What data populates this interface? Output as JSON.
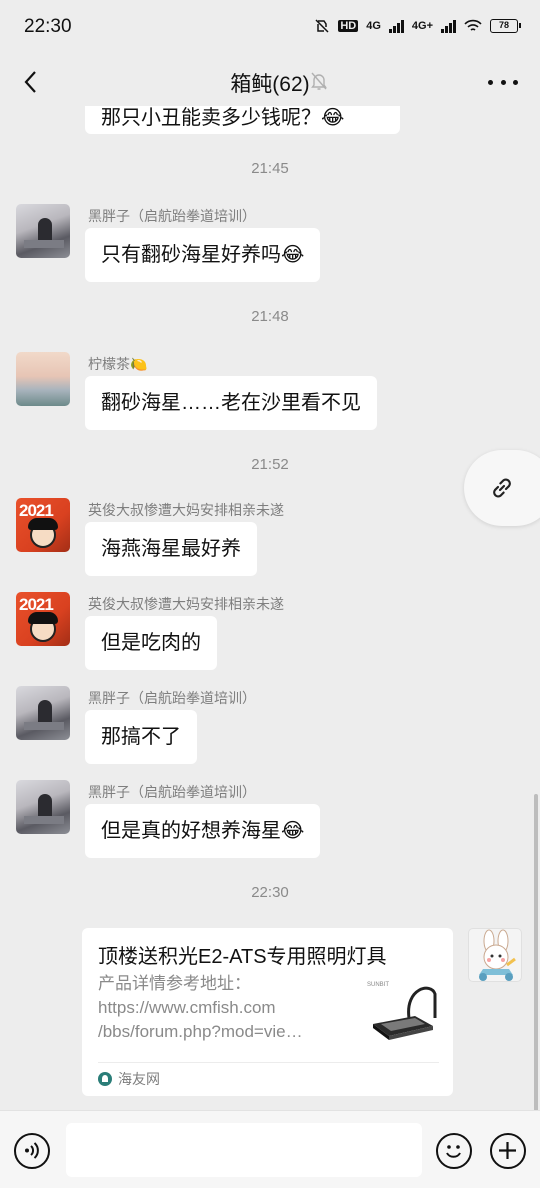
{
  "status": {
    "time": "22:30",
    "hd": "HD",
    "net1": "4G",
    "net2": "4G+",
    "battery": "78"
  },
  "header": {
    "title": "箱鲀(62)",
    "back_icon": "back-chevron-icon",
    "mute_icon": "bell-muted-icon",
    "more_icon": "more-dots-icon"
  },
  "chat": {
    "partial_message": "那只小丑能卖多少钱呢？😂",
    "times": [
      "21:45",
      "21:48",
      "21:52",
      "22:30"
    ],
    "messages": [
      {
        "sender": "黑胖子（启航跆拳道培训）",
        "text": "只有翻砂海星好养吗😂"
      },
      {
        "sender": "柠檬茶🍋",
        "text": "翻砂海星……老在沙里看不见"
      },
      {
        "sender": "英俊大叔惨遭大妈安排相亲未遂",
        "text": "海燕海星最好养"
      },
      {
        "sender": "英俊大叔惨遭大妈安排相亲未遂",
        "text": "但是吃肉的"
      },
      {
        "sender": "黑胖子（启航跆拳道培训）",
        "text": "那搞不了"
      },
      {
        "sender": "黑胖子（启航跆拳道培训）",
        "text": "但是真的好想养海星😂"
      }
    ],
    "link_card": {
      "title": "顶楼送积光E2-ATS专用照明灯具",
      "desc_line1": "产品详情参考地址：",
      "desc_line2": "https://www.cmfish.com",
      "desc_line3": "/bbs/forum.php?mod=vie…",
      "source": "海友网",
      "thumb_label": "SUNBIT"
    },
    "floating_link_icon": "link-icon"
  },
  "input": {
    "placeholder": "",
    "voice_icon": "voice-icon",
    "emoji_icon": "emoji-icon",
    "plus_icon": "plus-icon"
  }
}
